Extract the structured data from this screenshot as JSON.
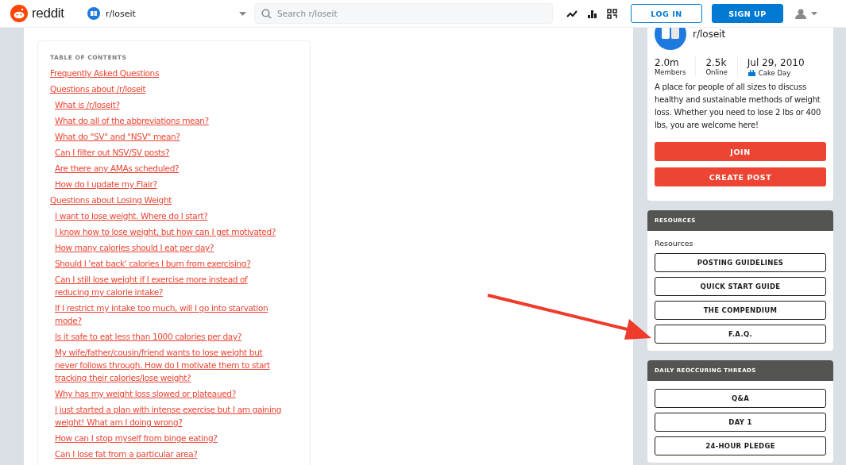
{
  "header": {
    "logo_text": "reddit",
    "community": "r/loseit",
    "search": {
      "placeholder": "Search r/loseit"
    },
    "buttons": [
      {
        "label": "LOG IN",
        "kind": "outline"
      },
      {
        "label": "SIGN UP",
        "kind": "filled"
      }
    ]
  },
  "toc": {
    "title": "TABLE OF CONTENTS",
    "items": [
      {
        "text": "Frequently Asked Questions"
      },
      {
        "text": "Questions about /r/loseit",
        "children": [
          {
            "text": "What is /r/loseit?"
          },
          {
            "text": "What do all of the abbreviations mean?"
          },
          {
            "text": "What do \"SV\" and \"NSV\" mean?"
          },
          {
            "text": "Can I filter out NSV/SV posts?"
          },
          {
            "text": "Are there any AMAs scheduled?"
          },
          {
            "text": "How do I update my Flair?"
          }
        ]
      },
      {
        "text": "Questions about Losing Weight",
        "children": [
          {
            "text": "I want to lose weight. Where do I start?"
          },
          {
            "text": "I know how to lose weight, but how can I get motivated?"
          },
          {
            "text": "How many calories should I eat per day?"
          },
          {
            "text": "Should I 'eat back' calories I burn from exercising?"
          },
          {
            "text": "Can I still lose weight if I exercise more instead of reducing my calorie intake?"
          },
          {
            "text": "If I restrict my intake too much, will I go into starvation mode?"
          },
          {
            "text": "Is it safe to eat less than 1000 calories per day?"
          },
          {
            "text": "My wife/father/cousin/friend wants to lose weight but never follows through. How do I motivate them to start tracking their calories/lose weight?"
          },
          {
            "text": "Why has my weight loss slowed or plateaued?"
          },
          {
            "text": "I just started a plan with intense exercise but I am gaining weight! What am I doing wrong?"
          },
          {
            "text": "How can I stop myself from binge eating?"
          },
          {
            "text": "Can I lose fat from a particular area?"
          }
        ]
      }
    ]
  },
  "community": {
    "name": "r/loseit",
    "stats": [
      {
        "value": "2.0m",
        "label": "Members",
        "kind": "count"
      },
      {
        "value": "2.5k",
        "label": "Online",
        "kind": "count"
      },
      {
        "value": "Jul 29, 2010",
        "label": "Cake Day",
        "kind": "date"
      }
    ],
    "description": "A place for people of all sizes to discuss healthy and sustainable methods of weight loss. Whether you need to lose 2 lbs or 400 lbs, you are welcome here!",
    "buttons": [
      "JOIN",
      "CREATE POST"
    ]
  },
  "widgets": [
    {
      "title": "RESOURCES",
      "label": "Resources",
      "buttons": [
        "POSTING GUIDELINES",
        "QUICK START GUIDE",
        "THE COMPENDIUM",
        "F.A.Q."
      ]
    },
    {
      "title": "DAILY REOCCURING THREADS",
      "buttons": [
        "Q&A",
        "DAY 1",
        "24-HOUR PLEDGE"
      ]
    }
  ]
}
